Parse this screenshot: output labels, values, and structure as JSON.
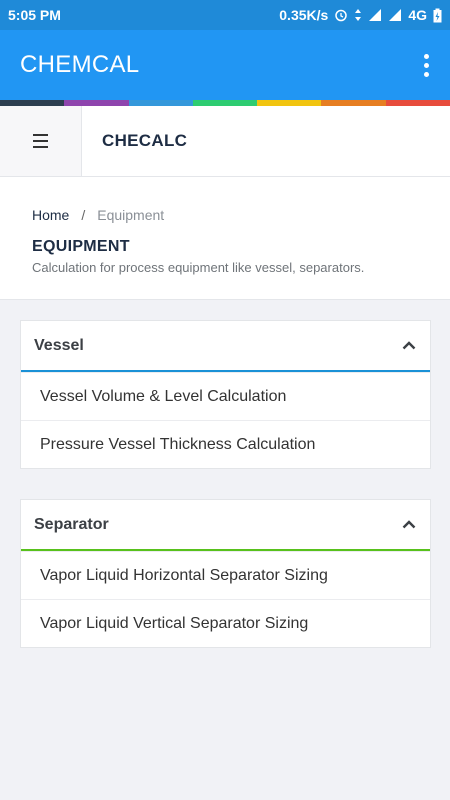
{
  "status_bar": {
    "time": "5:05 PM",
    "speed": "0.35K/s",
    "network": "4G"
  },
  "app_bar": {
    "title": "CHEMCAL",
    "menu_icon": "more-vert-icon"
  },
  "color_strip": [
    "#2c3e50",
    "#8e44ad",
    "#3498db",
    "#2ecc71",
    "#f1c40f",
    "#e67e22",
    "#e74c3c"
  ],
  "top_nav": {
    "menu_icon": "hamburger-icon",
    "brand": "CHECALC"
  },
  "page_header": {
    "breadcrumb": {
      "home": "Home",
      "separator": "/",
      "current": "Equipment"
    },
    "title": "EQUIPMENT",
    "description": "Calculation for process equipment like vessel, separators."
  },
  "sections": [
    {
      "title": "Vessel",
      "accent": "#1a91d6",
      "items": [
        "Vessel Volume & Level Calculation",
        "Pressure Vessel Thickness Calculation"
      ]
    },
    {
      "title": "Separator",
      "accent": "#58c11c",
      "items": [
        "Vapor Liquid Horizontal Separator Sizing",
        "Vapor Liquid Vertical Separator Sizing"
      ]
    }
  ]
}
